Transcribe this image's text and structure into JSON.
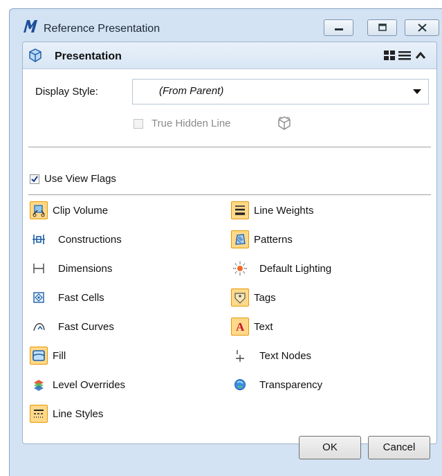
{
  "window": {
    "title": "Reference Presentation",
    "buttons": {
      "minimize": "minimize-icon",
      "maximize": "maximize-icon",
      "close": "close-icon"
    }
  },
  "panel": {
    "title": "Presentation",
    "header_icons": [
      "grid-view-icon",
      "list-view-icon",
      "collapse-chevron-icon"
    ]
  },
  "display_style": {
    "label": "Display Style:",
    "value": "(From Parent)"
  },
  "true_hidden_line": {
    "label": "True Hidden Line",
    "checked": false,
    "enabled": false
  },
  "use_view_flags": {
    "label": "Use View Flags",
    "checked": true
  },
  "flags": {
    "left": [
      {
        "label": "Clip Volume",
        "icon": "clip-volume-icon",
        "active": true
      },
      {
        "label": "Constructions",
        "icon": "constructions-icon",
        "active": false
      },
      {
        "label": "Dimensions",
        "icon": "dimensions-icon",
        "active": false
      },
      {
        "label": "Fast Cells",
        "icon": "fast-cells-icon",
        "active": false
      },
      {
        "label": "Fast Curves",
        "icon": "fast-curves-icon",
        "active": false
      },
      {
        "label": "Fill",
        "icon": "fill-icon",
        "active": true
      },
      {
        "label": "Level Overrides",
        "icon": "level-overrides-icon",
        "active": false
      },
      {
        "label": "Line Styles",
        "icon": "line-styles-icon",
        "active": true
      }
    ],
    "right": [
      {
        "label": "Line Weights",
        "icon": "line-weights-icon",
        "active": true
      },
      {
        "label": "Patterns",
        "icon": "patterns-icon",
        "active": true
      },
      {
        "label": "Default Lighting",
        "icon": "default-lighting-icon",
        "active": false
      },
      {
        "label": "Tags",
        "icon": "tags-icon",
        "active": true
      },
      {
        "label": "Text",
        "icon": "text-icon",
        "active": true
      },
      {
        "label": "Text Nodes",
        "icon": "text-nodes-icon",
        "active": false
      },
      {
        "label": "Transparency",
        "icon": "transparency-icon",
        "active": false
      }
    ]
  },
  "footer": {
    "ok_label": "OK",
    "cancel_label": "Cancel"
  },
  "colors": {
    "window_bg": "#d3e3f3",
    "active_icon_bg": "#ffd98a",
    "active_icon_border": "#e59700"
  }
}
